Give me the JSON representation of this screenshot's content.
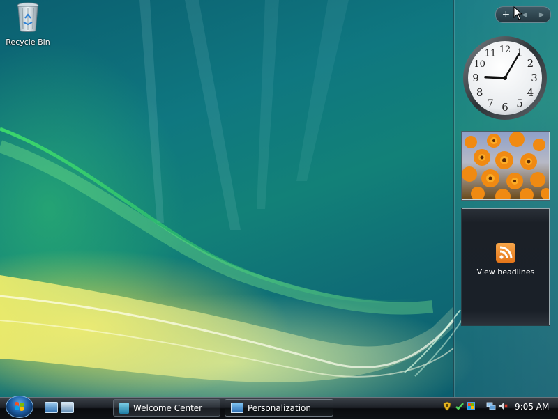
{
  "desktop": {
    "icons": [
      {
        "label": "Recycle Bin",
        "icon": "recycle-bin-icon"
      }
    ]
  },
  "sidebar": {
    "controls": {
      "add": "+",
      "prev": "◀",
      "next": "▶"
    },
    "clock": {
      "numerals": [
        "12",
        "1",
        "2",
        "3",
        "4",
        "5",
        "6",
        "7",
        "8",
        "9",
        "10",
        "11"
      ],
      "time": {
        "hour": 9,
        "minute": 5
      }
    },
    "slideshow": {
      "subject": "orange flowers"
    },
    "feed_headlines": {
      "label": "View headlines",
      "icon": "rss-feed-icon"
    }
  },
  "taskbar": {
    "start_icon": "windows-start-orb-icon",
    "quick_launch": [
      "show-desktop-icon",
      "switch-windows-icon"
    ],
    "buttons": [
      {
        "label": "Welcome Center",
        "icon": "welcome-center-icon",
        "active": false
      },
      {
        "label": "Personalization",
        "icon": "personalization-icon",
        "active": true
      }
    ],
    "tray_icons": [
      "security-shield-icon",
      "windows-defender-icon",
      "update-icon",
      "network-icon",
      "volume-muted-icon"
    ],
    "time": "9:05 AM"
  },
  "colors": {
    "taskbar_dark": "#0f1216",
    "wallpaper_teal": "#0f7780",
    "rss_orange": "#e5761a"
  }
}
